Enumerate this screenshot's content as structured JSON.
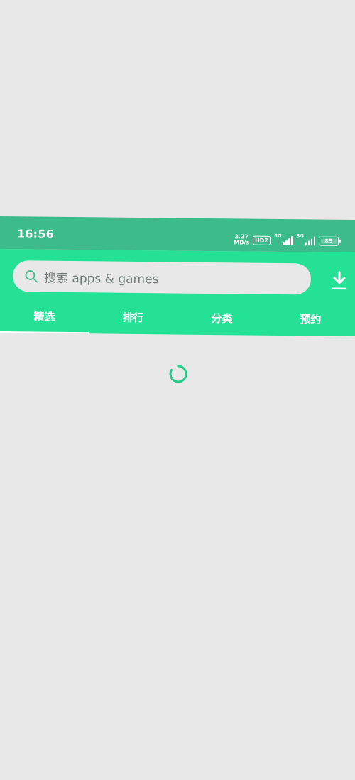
{
  "status_bar": {
    "time": "16:56",
    "net_speed_value": "2.27",
    "net_speed_unit": "MB/s",
    "hd_badge": "HD2",
    "signal1_gen": "5G",
    "signal2_gen": "5G",
    "battery_level": "85"
  },
  "search": {
    "placeholder": "搜索 apps & games",
    "icon": "search-icon"
  },
  "header": {
    "download_icon": "download-icon"
  },
  "tabs": [
    {
      "label": "精选",
      "active": true
    },
    {
      "label": "排行",
      "active": false
    },
    {
      "label": "分类",
      "active": false
    },
    {
      "label": "预约",
      "active": false
    }
  ],
  "colors": {
    "status_bar": "#3dbb8b",
    "header": "#25e196",
    "background": "#e8e8e8",
    "spinner": "#25c98a"
  }
}
